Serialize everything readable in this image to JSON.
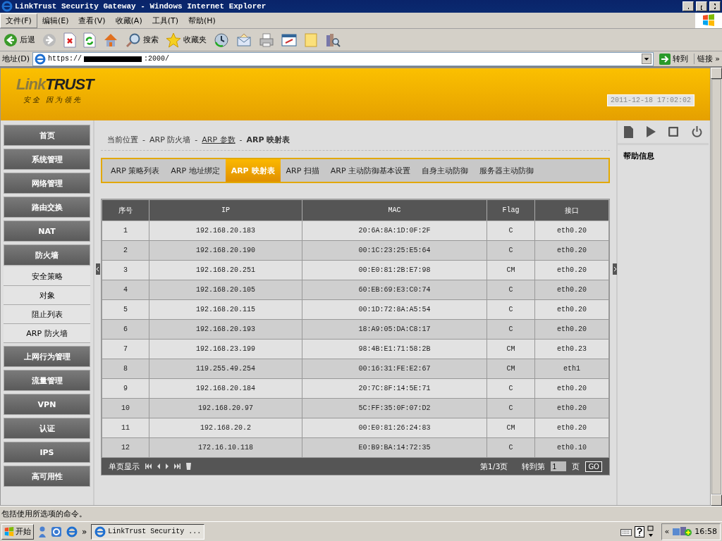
{
  "window": {
    "title": "LinkTrust Security Gateway - Windows Internet Explorer"
  },
  "menu": [
    {
      "label": "文件(F)",
      "selected": true
    },
    {
      "label": "编辑(E)",
      "selected": false
    },
    {
      "label": "查看(V)",
      "selected": false
    },
    {
      "label": "收藏(A)",
      "selected": false
    },
    {
      "label": "工具(T)",
      "selected": false
    },
    {
      "label": "帮助(H)",
      "selected": false
    }
  ],
  "toolbar": [
    {
      "kind": "back",
      "label": "后退"
    },
    {
      "kind": "forward"
    },
    {
      "kind": "stop"
    },
    {
      "kind": "refresh"
    },
    {
      "kind": "home"
    },
    {
      "kind": "search",
      "label": "搜索"
    },
    {
      "kind": "favorites",
      "label": "收藏夹"
    },
    {
      "kind": "history"
    },
    {
      "kind": "mail"
    },
    {
      "kind": "print"
    },
    {
      "kind": "edit"
    },
    {
      "kind": "note"
    },
    {
      "kind": "research"
    }
  ],
  "address": {
    "label": "地址(D)",
    "url_prefix": "https://",
    "url_suffix": ":2000/",
    "go": "转到",
    "links": "链接",
    "links_more": "»"
  },
  "header": {
    "logo_left": "Link",
    "logo_right": "TRUST",
    "slogan": "安全 因为领先",
    "datetime": "2011-12-18 17:02:02"
  },
  "nav": [
    {
      "label": "首页"
    },
    {
      "label": "系统管理"
    },
    {
      "label": "网络管理"
    },
    {
      "label": "路由交换"
    },
    {
      "label": "NAT"
    },
    {
      "label": "防火墙",
      "children": [
        {
          "label": "安全策略"
        },
        {
          "label": "对象"
        },
        {
          "label": "阻止列表"
        },
        {
          "label": "ARP 防火墙"
        }
      ]
    },
    {
      "label": "上网行为管理"
    },
    {
      "label": "流量管理"
    },
    {
      "label": "VPN"
    },
    {
      "label": "认证"
    },
    {
      "label": "IPS"
    },
    {
      "label": "高可用性"
    }
  ],
  "breadcrumb": {
    "separator": "-",
    "items": [
      {
        "label": "当前位置",
        "kind": "text"
      },
      {
        "label": "ARP 防火墙",
        "kind": "text"
      },
      {
        "label": "ARP 参数",
        "kind": "link"
      },
      {
        "label": "ARP 映射表",
        "kind": "current"
      }
    ]
  },
  "tabs": [
    {
      "label": "ARP 策略列表",
      "selected": false
    },
    {
      "label": "ARP 地址绑定",
      "selected": false
    },
    {
      "label": "ARP 映射表",
      "selected": true
    },
    {
      "label": "ARP 扫描",
      "selected": false
    },
    {
      "label": "ARP 主动防御基本设置",
      "selected": false
    },
    {
      "label": "自身主动防御",
      "selected": false
    },
    {
      "label": "服务器主动防御",
      "selected": false
    }
  ],
  "table": {
    "columns": [
      "序号",
      "IP",
      "MAC",
      "Flag",
      "接口"
    ],
    "rows": [
      [
        "1",
        "192.168.20.183",
        "20:6A:8A:1D:0F:2F",
        "C",
        "eth0.20"
      ],
      [
        "2",
        "192.168.20.190",
        "00:1C:23:25:E5:64",
        "C",
        "eth0.20"
      ],
      [
        "3",
        "192.168.20.251",
        "00:E0:81:2B:E7:98",
        "CM",
        "eth0.20"
      ],
      [
        "4",
        "192.168.20.105",
        "60:EB:69:E3:C0:74",
        "C",
        "eth0.20"
      ],
      [
        "5",
        "192.168.20.115",
        "00:1D:72:8A:A5:54",
        "C",
        "eth0.20"
      ],
      [
        "6",
        "192.168.20.193",
        "18:A9:05:DA:C8:17",
        "C",
        "eth0.20"
      ],
      [
        "7",
        "192.168.23.199",
        "98:4B:E1:71:58:2B",
        "CM",
        "eth0.23"
      ],
      [
        "8",
        "119.255.49.254",
        "00:16:31:FE:E2:67",
        "CM",
        "eth1"
      ],
      [
        "9",
        "192.168.20.184",
        "20:7C:8F:14:5E:71",
        "C",
        "eth0.20"
      ],
      [
        "10",
        "192.168.20.97",
        "5C:FF:35:0F:07:D2",
        "C",
        "eth0.20"
      ],
      [
        "11",
        "192.168.20.2",
        "00:E0:81:26:24:83",
        "CM",
        "eth0.20"
      ],
      [
        "12",
        "172.16.10.118",
        "E0:B9:BA:14:72:35",
        "C",
        "eth0.10"
      ]
    ]
  },
  "pager": {
    "label": "单页显示",
    "page": "第1/3页",
    "goto_label": "转到第",
    "goto_value": "1",
    "page_unit": "页",
    "go": "GO"
  },
  "help": {
    "title": "帮助信息"
  },
  "status_bar": "包括使用所选项的命令。",
  "taskbar": {
    "start": "开始",
    "more": "»",
    "task": "LinkTrust Security ...",
    "tray_more": "«",
    "clock": "16:58"
  }
}
